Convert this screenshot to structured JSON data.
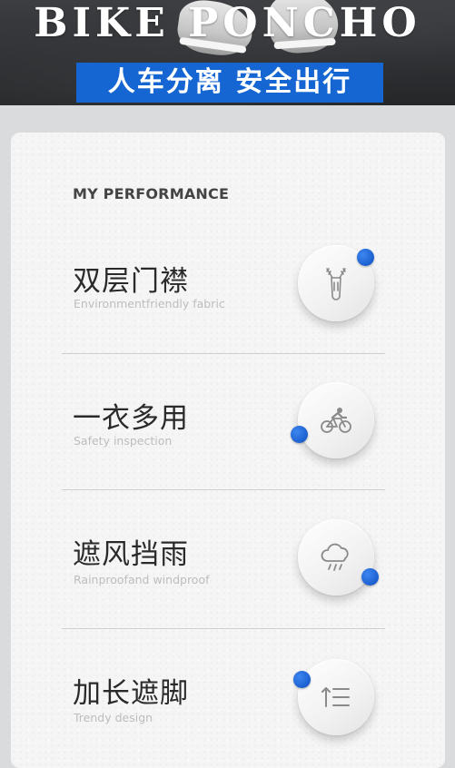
{
  "banner": {
    "title": "BIKE PONCHO",
    "slogan": "人车分离 安全出行"
  },
  "section": {
    "heading": "MY PERFORMANCE"
  },
  "features": [
    {
      "title": "双层门襟",
      "subtitle": "Environmentfriendly fabric",
      "icon": "zipper-icon"
    },
    {
      "title": "一衣多用",
      "subtitle": "Safety inspection",
      "icon": "cyclist-icon"
    },
    {
      "title": "遮风挡雨",
      "subtitle": "Rainproofand windproof",
      "icon": "rain-cloud-icon"
    },
    {
      "title": "加长遮脚",
      "subtitle": "Trendy design",
      "icon": "length-icon"
    }
  ],
  "colors": {
    "accent": "#1566d3",
    "dot": "#1b5fd0"
  }
}
